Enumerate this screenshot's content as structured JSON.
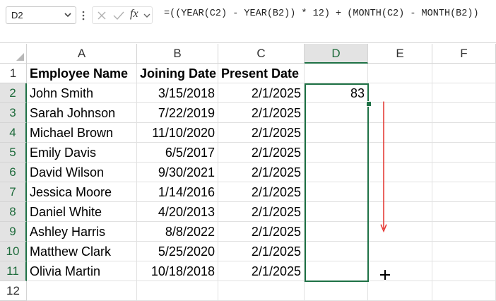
{
  "name_box": {
    "value": "D2"
  },
  "formula_bar": {
    "fx_symbol": "fx",
    "formula": "=((YEAR(C2) - YEAR(B2)) * 12) + (MONTH(C2) - MONTH(B2))"
  },
  "columns": [
    "A",
    "B",
    "C",
    "D",
    "E",
    "F"
  ],
  "rows": [
    "1",
    "2",
    "3",
    "4",
    "5",
    "6",
    "7",
    "8",
    "9",
    "10",
    "11",
    "12"
  ],
  "header_row": {
    "a": "Employee Name",
    "b": "Joining Date",
    "c": "Present Date"
  },
  "data_rows": [
    {
      "a": "John Smith",
      "b": "3/15/2018",
      "c": "2/1/2025",
      "d": "83"
    },
    {
      "a": "Sarah Johnson",
      "b": "7/22/2019",
      "c": "2/1/2025",
      "d": ""
    },
    {
      "a": "Michael Brown",
      "b": "11/10/2020",
      "c": "2/1/2025",
      "d": ""
    },
    {
      "a": "Emily Davis",
      "b": "6/5/2017",
      "c": "2/1/2025",
      "d": ""
    },
    {
      "a": "David Wilson",
      "b": "9/30/2021",
      "c": "2/1/2025",
      "d": ""
    },
    {
      "a": "Jessica Moore",
      "b": "1/14/2016",
      "c": "2/1/2025",
      "d": ""
    },
    {
      "a": "Daniel White",
      "b": "4/20/2013",
      "c": "2/1/2025",
      "d": ""
    },
    {
      "a": "Ashley Harris",
      "b": "8/8/2022",
      "c": "2/1/2025",
      "d": ""
    },
    {
      "a": "Matthew Clark",
      "b": "5/25/2020",
      "c": "2/1/2025",
      "d": ""
    },
    {
      "a": "Olivia Martin",
      "b": "10/18/2018",
      "c": "2/1/2025",
      "d": ""
    }
  ],
  "colors": {
    "selection": "#1e7145",
    "arrow": "#e53935",
    "header_selected_bg": "#e3e3e3"
  },
  "icons": [
    "chevron-down-icon",
    "more-options-icon",
    "cancel-x-icon",
    "confirm-check-icon",
    "fx-icon",
    "expand-chevron-icon",
    "drag-arrow-icon",
    "crosshair-cursor-icon"
  ]
}
